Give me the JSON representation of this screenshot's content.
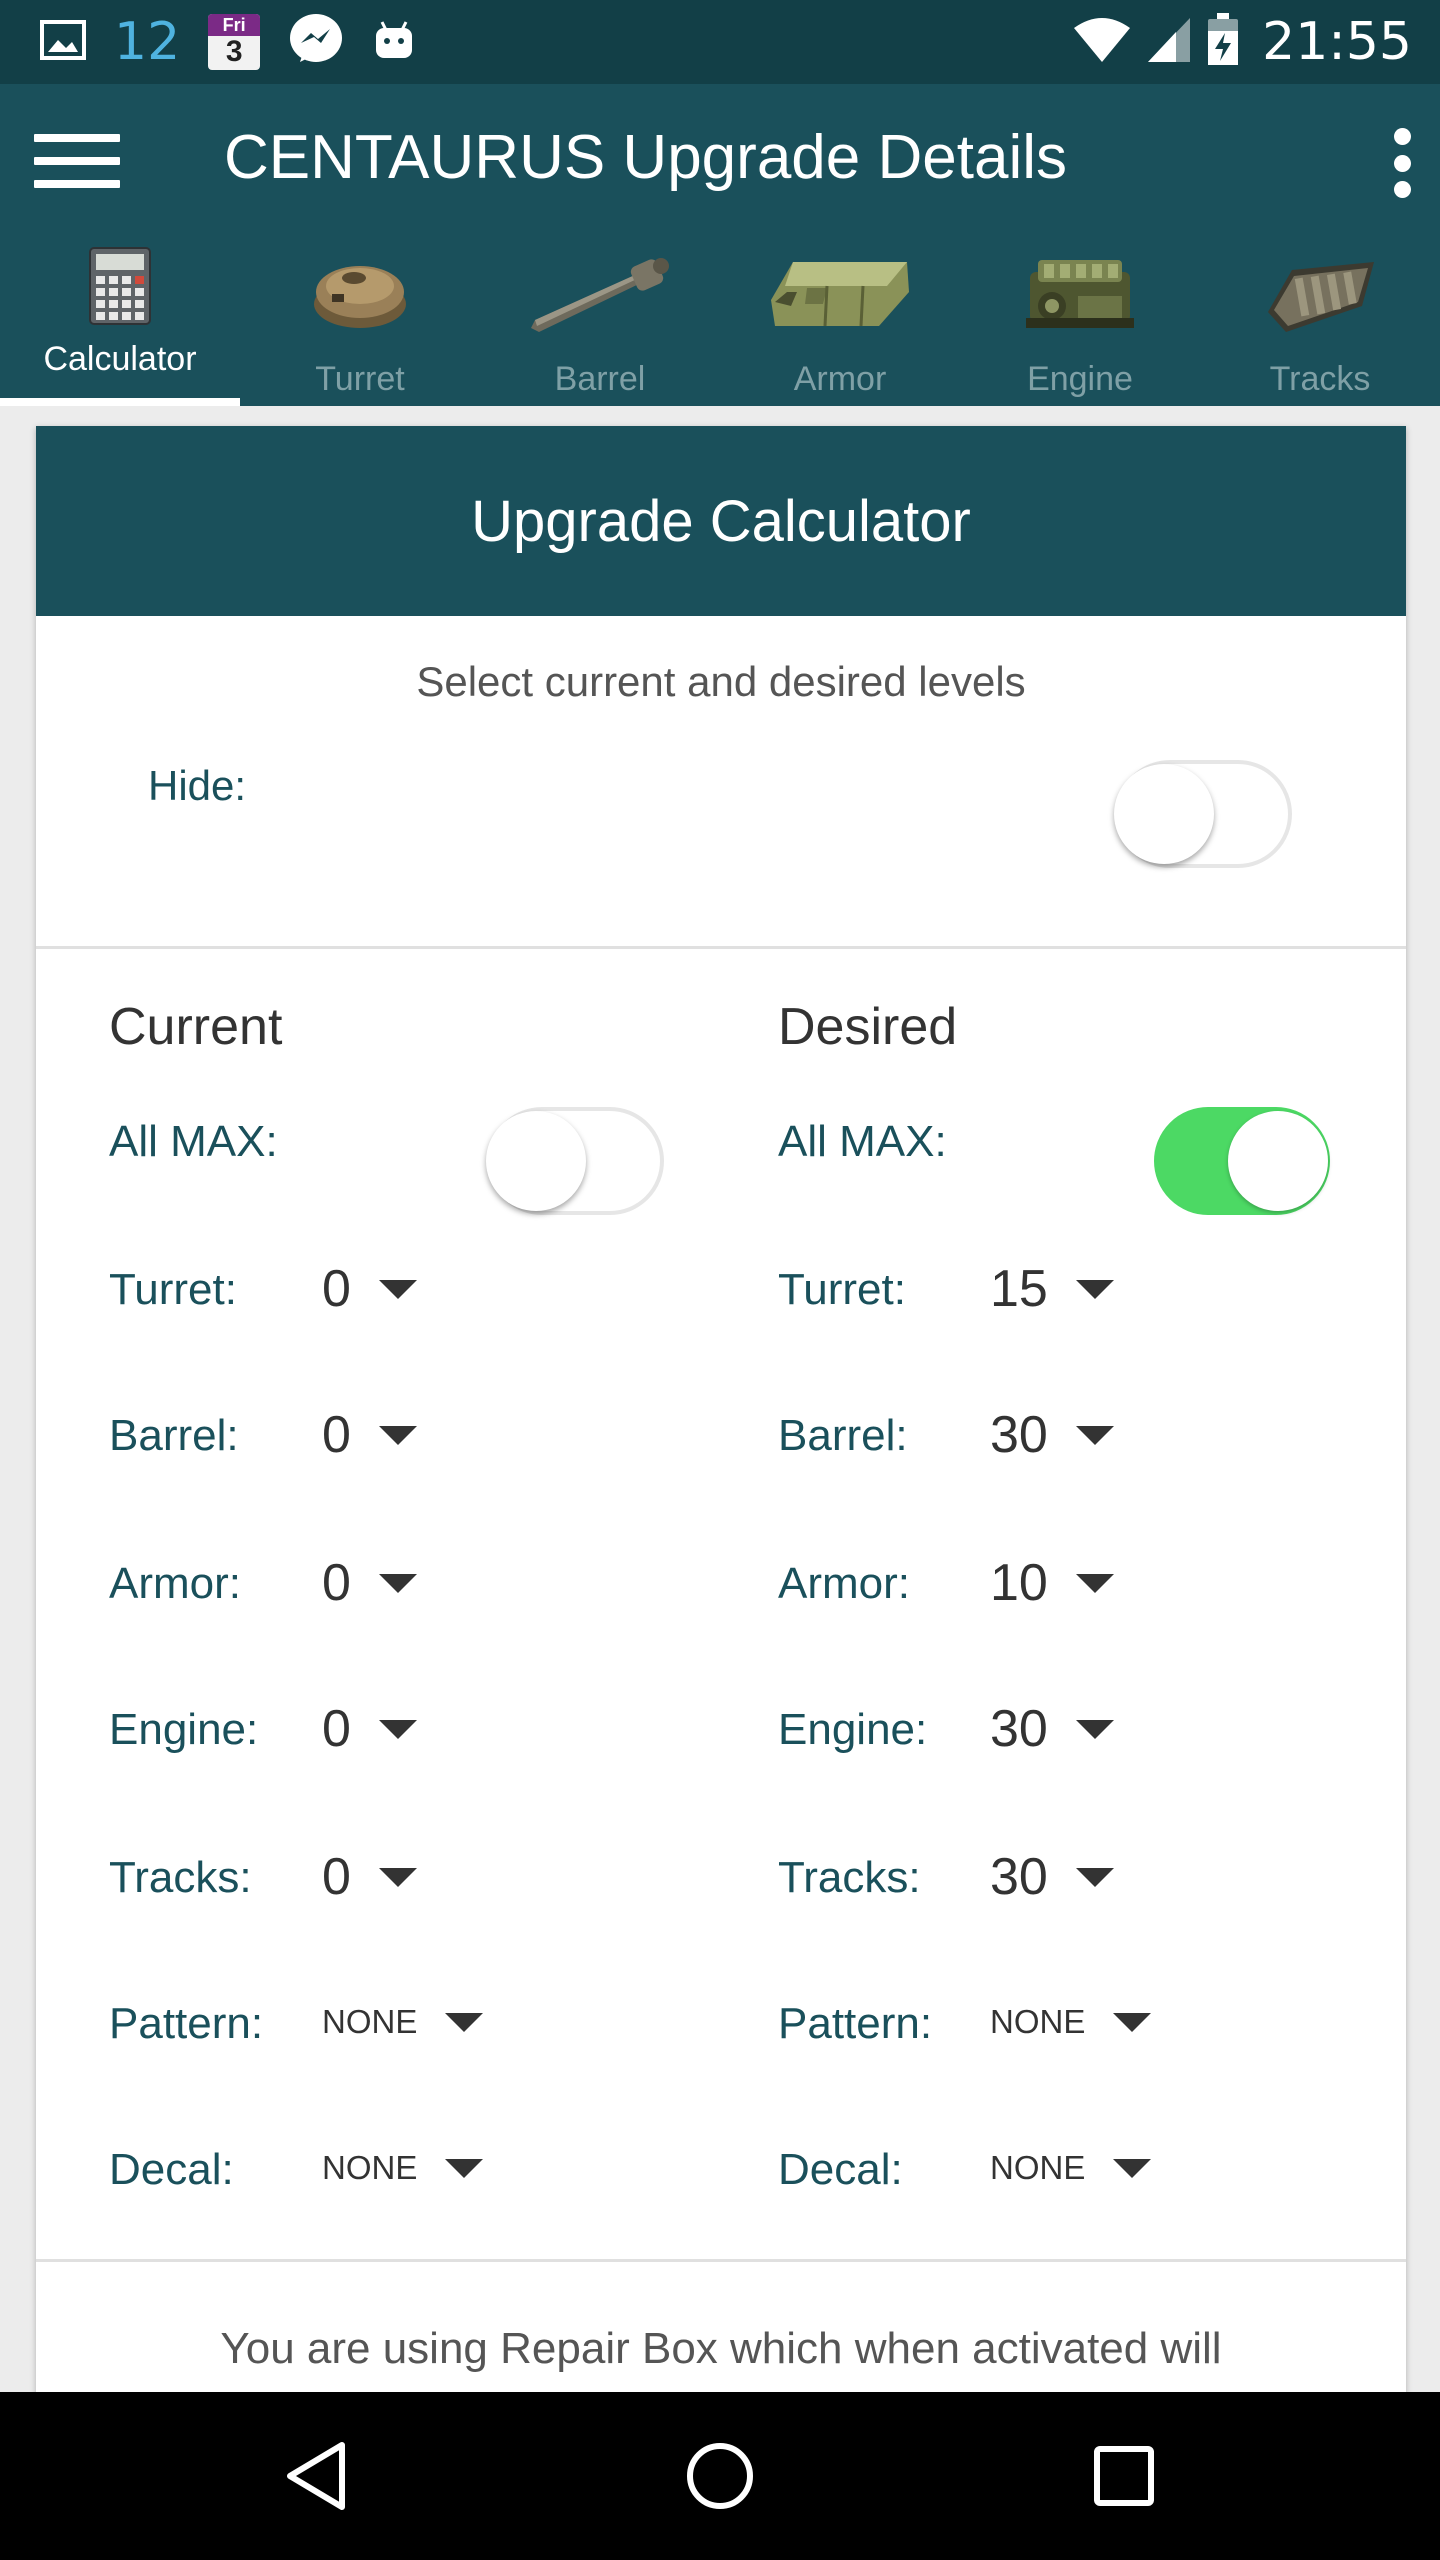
{
  "status_bar": {
    "notification_count": "12",
    "calendar_day_name": "Fri",
    "calendar_day_number": "3",
    "time": "21:55",
    "icons": [
      "image-icon",
      "calendar-icon",
      "messenger-icon",
      "android-icon",
      "wifi-icon",
      "signal-icon",
      "battery-icon"
    ]
  },
  "app_bar": {
    "title": "CENTAURUS Upgrade Details"
  },
  "tabs": [
    {
      "label": "Calculator",
      "icon": "calculator-icon",
      "active": true
    },
    {
      "label": "Turret",
      "icon": "turret-icon",
      "active": false
    },
    {
      "label": "Barrel",
      "icon": "barrel-icon",
      "active": false
    },
    {
      "label": "Armor",
      "icon": "armor-icon",
      "active": false
    },
    {
      "label": "Engine",
      "icon": "engine-icon",
      "active": false
    },
    {
      "label": "Tracks",
      "icon": "tracks-icon",
      "active": false
    }
  ],
  "card": {
    "title": "Upgrade Calculator",
    "instruction": "Select current and desired levels",
    "hide_label": "Hide:",
    "hide_enabled": false
  },
  "current": {
    "heading": "Current",
    "all_max_label": "All MAX:",
    "all_max_enabled": false,
    "rows": [
      {
        "label": "Turret:",
        "value": "0"
      },
      {
        "label": "Barrel:",
        "value": "0"
      },
      {
        "label": "Armor:",
        "value": "0"
      },
      {
        "label": "Engine:",
        "value": "0"
      },
      {
        "label": "Tracks:",
        "value": "0"
      },
      {
        "label": "Pattern:",
        "value": "NONE"
      },
      {
        "label": "Decal:",
        "value": "NONE"
      }
    ]
  },
  "desired": {
    "heading": "Desired",
    "all_max_label": "All MAX:",
    "all_max_enabled": true,
    "rows": [
      {
        "label": "Turret:",
        "value": "15"
      },
      {
        "label": "Barrel:",
        "value": "30"
      },
      {
        "label": "Armor:",
        "value": "10"
      },
      {
        "label": "Engine:",
        "value": "30"
      },
      {
        "label": "Tracks:",
        "value": "30"
      },
      {
        "label": "Pattern:",
        "value": "NONE"
      },
      {
        "label": "Decal:",
        "value": "NONE"
      }
    ]
  },
  "footer_text": "You are using Repair Box which when activated will",
  "colors": {
    "primary": "#1a505b",
    "status_bar": "#123f47",
    "switch_on": "#4cd964"
  }
}
